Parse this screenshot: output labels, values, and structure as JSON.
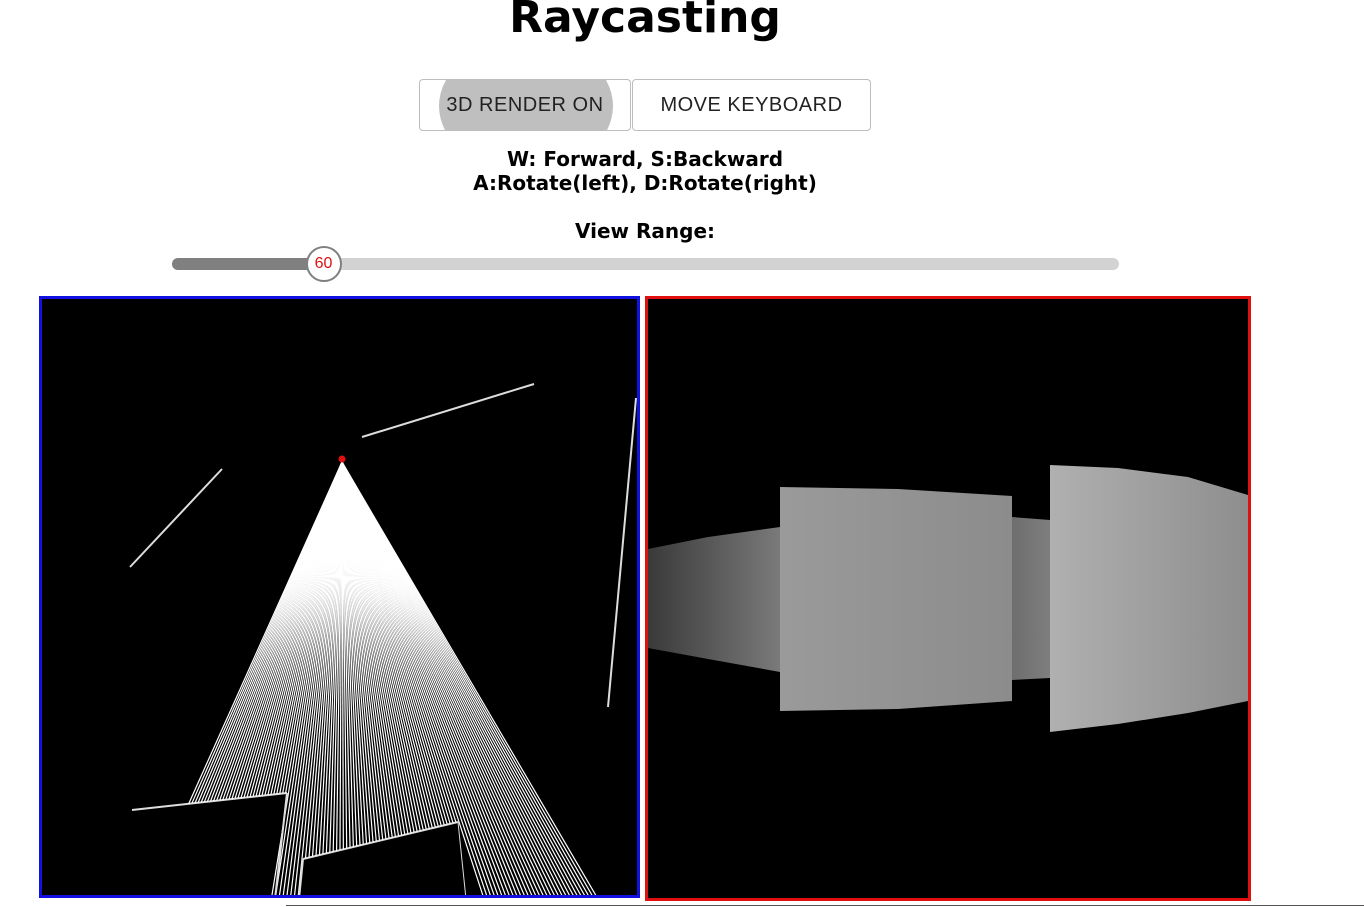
{
  "page": {
    "title": "Raycasting"
  },
  "controls": {
    "render_toggle_label": "3D RENDER ON",
    "keyboard_button_label": "MOVE KEYBOARD"
  },
  "instructions": {
    "line1": "W: Forward, S:Backward",
    "line2": "A:Rotate(left), D:Rotate(right)"
  },
  "view_range": {
    "label": "View Range:",
    "value": "60",
    "fraction": 0.16
  },
  "colors": {
    "map_border": "#1010e0",
    "view_border": "#e01010",
    "player_dot": "#e01010",
    "rays": "#ffffff",
    "walls": "#dddddd",
    "background": "#000000"
  }
}
